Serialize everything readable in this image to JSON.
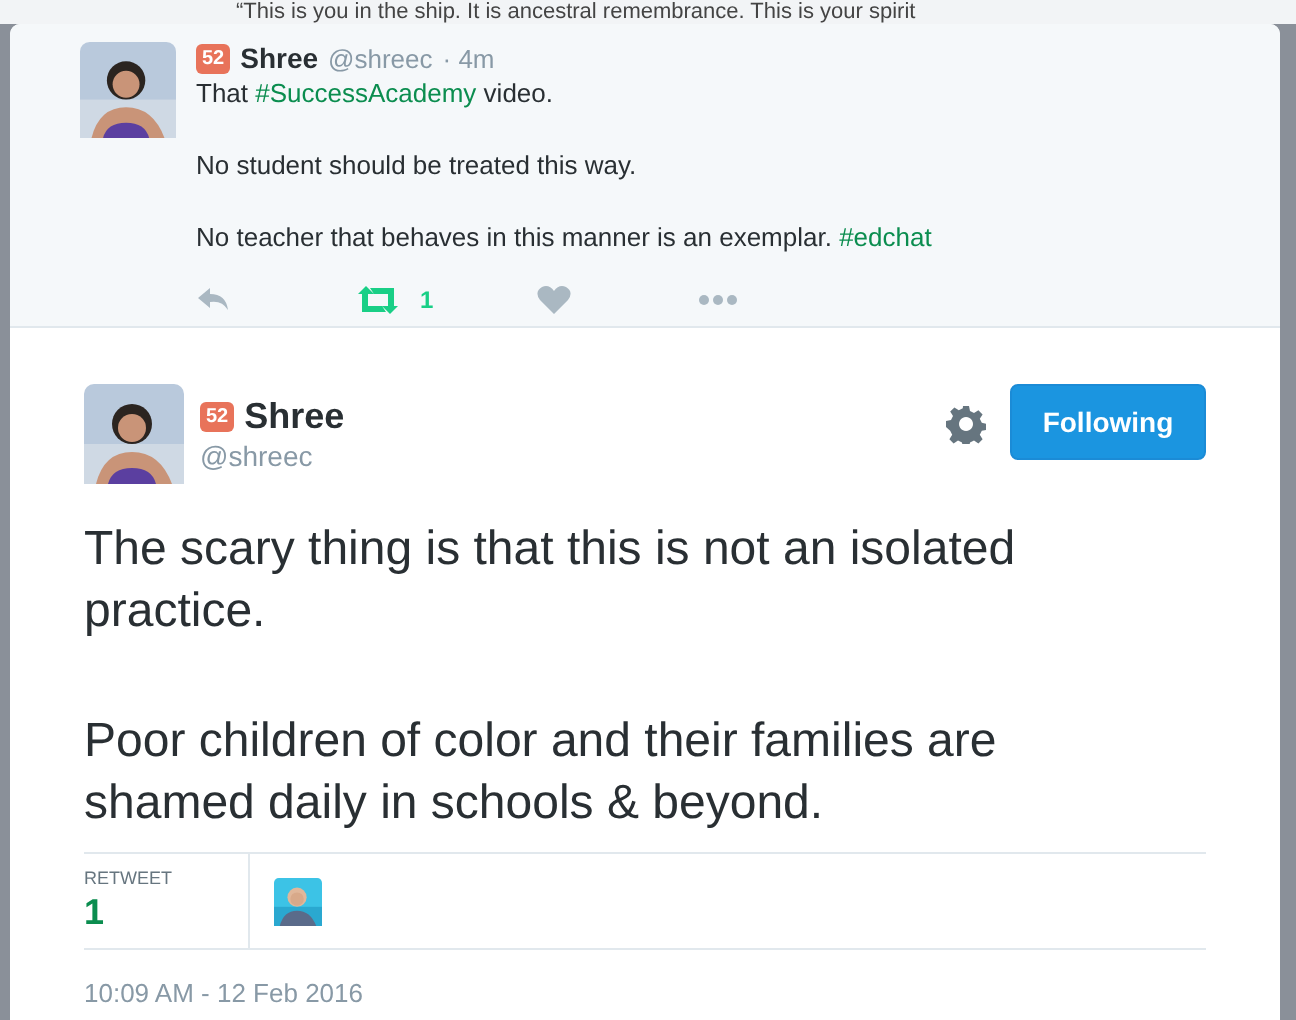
{
  "background_tweet": {
    "text": "“This is you in the ship. It is ancestral remembrance. This is your spirit"
  },
  "parent_tweet": {
    "badge": "52",
    "name": "Shree",
    "handle": "@shreec",
    "time": "· 4m",
    "paragraphs": [
      [
        {
          "kind": "plain",
          "text": "That "
        },
        {
          "kind": "hashtag",
          "text": "#SuccessAcademy"
        },
        {
          "kind": "plain",
          "text": " video."
        }
      ],
      [
        {
          "kind": "plain",
          "text": "No student should be treated this way."
        }
      ],
      [
        {
          "kind": "plain",
          "text": "No teacher that behaves in this manner is an exemplar. "
        },
        {
          "kind": "hashtag",
          "text": "#edchat"
        }
      ]
    ],
    "retweet_count": "1"
  },
  "tweet": {
    "badge": "52",
    "name": "Shree",
    "handle": "@shreec",
    "follow_button": "Following",
    "paragraphs": [
      "The scary thing is that this is not an isolated practice.",
      "Poor children of color and their families are shamed daily in schools & beyond."
    ],
    "stat_label": "RETWEET",
    "stat_count": "1",
    "timestamp": "10:09 AM - 12 Feb 2016"
  }
}
